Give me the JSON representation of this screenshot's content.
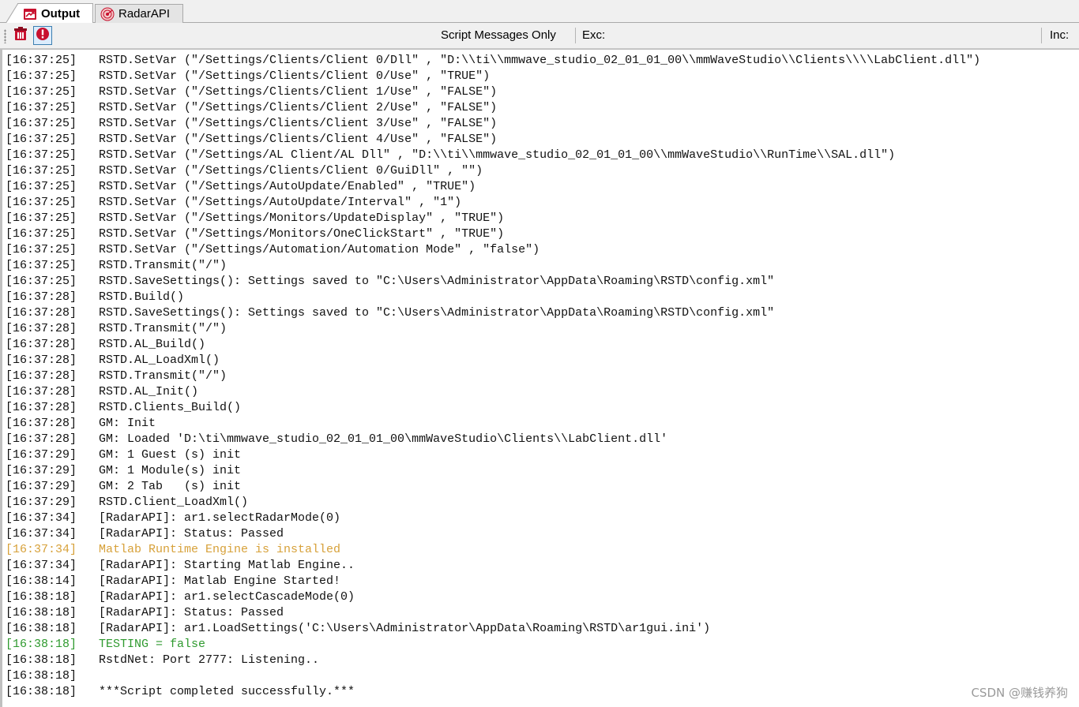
{
  "tabs": {
    "output_label": "Output",
    "radar_label": "RadarAPI"
  },
  "toolbar": {
    "clear_icon": "trash-clear-icon",
    "stop_icon": "stop-icon",
    "script_messages_label": "Script Messages Only",
    "exc_label": "Exc:",
    "exc_value": "",
    "inc_label": "Inc:"
  },
  "colors": {
    "warning": "#d7a13a",
    "success": "#2f9a2f",
    "text": "#111111"
  },
  "log": [
    {
      "ts": "[16:37:25]",
      "msg": "RSTD.SetVar (\"/Settings/Clients/Client 0/Dll\" , \"D:\\\\ti\\\\mmwave_studio_02_01_01_00\\\\mmWaveStudio\\\\Clients\\\\\\\\LabClient.dll\")",
      "level": "normal"
    },
    {
      "ts": "[16:37:25]",
      "msg": "RSTD.SetVar (\"/Settings/Clients/Client 0/Use\" , \"TRUE\")",
      "level": "normal"
    },
    {
      "ts": "[16:37:25]",
      "msg": "RSTD.SetVar (\"/Settings/Clients/Client 1/Use\" , \"FALSE\")",
      "level": "normal"
    },
    {
      "ts": "[16:37:25]",
      "msg": "RSTD.SetVar (\"/Settings/Clients/Client 2/Use\" , \"FALSE\")",
      "level": "normal"
    },
    {
      "ts": "[16:37:25]",
      "msg": "RSTD.SetVar (\"/Settings/Clients/Client 3/Use\" , \"FALSE\")",
      "level": "normal"
    },
    {
      "ts": "[16:37:25]",
      "msg": "RSTD.SetVar (\"/Settings/Clients/Client 4/Use\" , \"FALSE\")",
      "level": "normal"
    },
    {
      "ts": "[16:37:25]",
      "msg": "RSTD.SetVar (\"/Settings/AL Client/AL Dll\" , \"D:\\\\ti\\\\mmwave_studio_02_01_01_00\\\\mmWaveStudio\\\\RunTime\\\\SAL.dll\")",
      "level": "normal"
    },
    {
      "ts": "[16:37:25]",
      "msg": "RSTD.SetVar (\"/Settings/Clients/Client 0/GuiDll\" , \"\")",
      "level": "normal"
    },
    {
      "ts": "[16:37:25]",
      "msg": "RSTD.SetVar (\"/Settings/AutoUpdate/Enabled\" , \"TRUE\")",
      "level": "normal"
    },
    {
      "ts": "[16:37:25]",
      "msg": "RSTD.SetVar (\"/Settings/AutoUpdate/Interval\" , \"1\")",
      "level": "normal"
    },
    {
      "ts": "[16:37:25]",
      "msg": "RSTD.SetVar (\"/Settings/Monitors/UpdateDisplay\" , \"TRUE\")",
      "level": "normal"
    },
    {
      "ts": "[16:37:25]",
      "msg": "RSTD.SetVar (\"/Settings/Monitors/OneClickStart\" , \"TRUE\")",
      "level": "normal"
    },
    {
      "ts": "[16:37:25]",
      "msg": "RSTD.SetVar (\"/Settings/Automation/Automation Mode\" , \"false\")",
      "level": "normal"
    },
    {
      "ts": "[16:37:25]",
      "msg": "RSTD.Transmit(\"/\")",
      "level": "normal"
    },
    {
      "ts": "[16:37:25]",
      "msg": "RSTD.SaveSettings(): Settings saved to \"C:\\Users\\Administrator\\AppData\\Roaming\\RSTD\\config.xml\"",
      "level": "normal"
    },
    {
      "ts": "[16:37:28]",
      "msg": "RSTD.Build()",
      "level": "normal"
    },
    {
      "ts": "[16:37:28]",
      "msg": "RSTD.SaveSettings(): Settings saved to \"C:\\Users\\Administrator\\AppData\\Roaming\\RSTD\\config.xml\"",
      "level": "normal"
    },
    {
      "ts": "[16:37:28]",
      "msg": "RSTD.Transmit(\"/\")",
      "level": "normal"
    },
    {
      "ts": "[16:37:28]",
      "msg": "RSTD.AL_Build()",
      "level": "normal"
    },
    {
      "ts": "[16:37:28]",
      "msg": "RSTD.AL_LoadXml()",
      "level": "normal"
    },
    {
      "ts": "[16:37:28]",
      "msg": "RSTD.Transmit(\"/\")",
      "level": "normal"
    },
    {
      "ts": "[16:37:28]",
      "msg": "RSTD.AL_Init()",
      "level": "normal"
    },
    {
      "ts": "[16:37:28]",
      "msg": "RSTD.Clients_Build()",
      "level": "normal"
    },
    {
      "ts": "[16:37:28]",
      "msg": "GM: Init",
      "level": "normal"
    },
    {
      "ts": "[16:37:28]",
      "msg": "GM: Loaded 'D:\\ti\\mmwave_studio_02_01_01_00\\mmWaveStudio\\Clients\\\\LabClient.dll'",
      "level": "normal"
    },
    {
      "ts": "[16:37:29]",
      "msg": "GM: 1 Guest (s) init",
      "level": "normal"
    },
    {
      "ts": "[16:37:29]",
      "msg": "GM: 1 Module(s) init",
      "level": "normal"
    },
    {
      "ts": "[16:37:29]",
      "msg": "GM: 2 Tab   (s) init",
      "level": "normal"
    },
    {
      "ts": "[16:37:29]",
      "msg": "RSTD.Client_LoadXml()",
      "level": "normal"
    },
    {
      "ts": "[16:37:34]",
      "msg": "[RadarAPI]: ar1.selectRadarMode(0)",
      "level": "normal"
    },
    {
      "ts": "[16:37:34]",
      "msg": "[RadarAPI]: Status: Passed",
      "level": "normal"
    },
    {
      "ts": "[16:37:34]",
      "msg": "Matlab Runtime Engine is installed",
      "level": "warn"
    },
    {
      "ts": "[16:37:34]",
      "msg": "[RadarAPI]: Starting Matlab Engine..",
      "level": "normal"
    },
    {
      "ts": "[16:38:14]",
      "msg": "[RadarAPI]: Matlab Engine Started!",
      "level": "normal"
    },
    {
      "ts": "[16:38:18]",
      "msg": "[RadarAPI]: ar1.selectCascadeMode(0)",
      "level": "normal"
    },
    {
      "ts": "[16:38:18]",
      "msg": "[RadarAPI]: Status: Passed",
      "level": "normal"
    },
    {
      "ts": "[16:38:18]",
      "msg": "[RadarAPI]: ar1.LoadSettings('C:\\Users\\Administrator\\AppData\\Roaming\\RSTD\\ar1gui.ini')",
      "level": "normal"
    },
    {
      "ts": "[16:38:18]",
      "msg": "TESTING = false",
      "level": "ok"
    },
    {
      "ts": "[16:38:18]",
      "msg": "RstdNet: Port 2777: Listening..",
      "level": "normal"
    },
    {
      "ts": "[16:38:18]",
      "msg": "",
      "level": "normal"
    },
    {
      "ts": "[16:38:18]",
      "msg": "***Script completed successfully.***",
      "level": "normal"
    }
  ],
  "watermark": "CSDN @赚钱养狗"
}
